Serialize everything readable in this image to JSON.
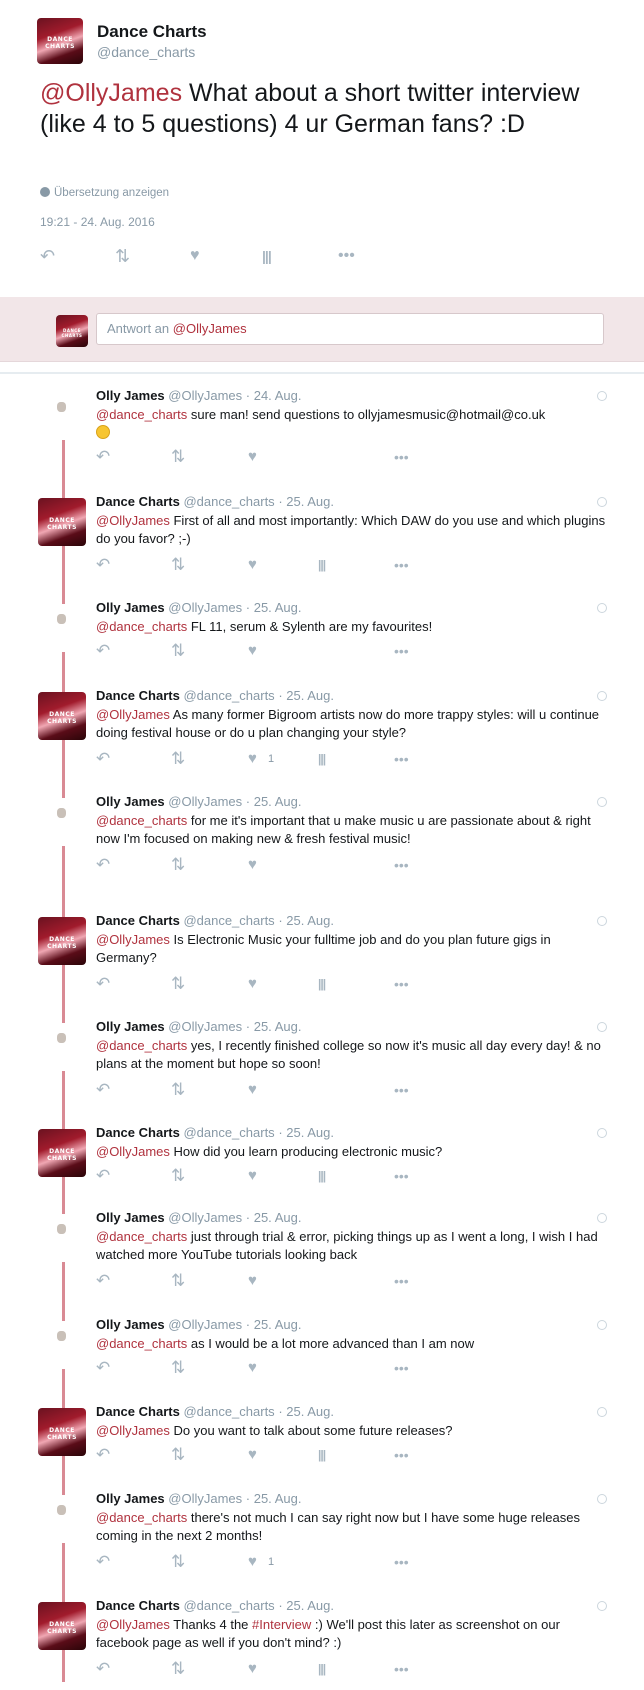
{
  "main_tweet": {
    "author_name": "Dance Charts",
    "author_handle": "@dance_charts",
    "mention": "@OllyJames",
    "text": " What about a short twitter interview (like 4 to 5 questions) 4 ur German fans? :D",
    "translate_label": "Übersetzung anzeigen",
    "timestamp": "19:21 - 24. Aug. 2016"
  },
  "reply_box": {
    "prefix": "Antwort an ",
    "mention": "@OllyJames"
  },
  "avatar_text": "DANCE CHARTS",
  "icons": {
    "reply": "reply-icon",
    "retweet": "retweet-icon",
    "like": "heart-icon",
    "analytics": "analytics-icon",
    "more": "more-icon"
  },
  "colors": {
    "accent": "#b0323e",
    "thread_line": "#d98a94",
    "reply_band": "#f2e6e8",
    "icon": "#a8b6c1"
  },
  "tweets": [
    {
      "name": "Olly James",
      "handle": "@OllyJames",
      "date": "· 24. Aug.",
      "mention": "@dance_charts",
      "text": " sure man! send questions to ollyjamesmusic@hotmail@co.uk",
      "likes": ""
    },
    {
      "name": "Dance Charts",
      "handle": "@dance_charts",
      "date": "· 25. Aug.",
      "mention": "@OllyJames",
      "text": " First of all and most importantly: Which DAW do you use and which plugins do you favor? ;-)",
      "likes": ""
    },
    {
      "name": "Olly James",
      "handle": "@OllyJames",
      "date": "· 25. Aug.",
      "mention": "@dance_charts",
      "text": " FL 11, serum & Sylenth are my favourites!",
      "likes": ""
    },
    {
      "name": "Dance Charts",
      "handle": "@dance_charts",
      "date": "· 25. Aug.",
      "mention": "@OllyJames",
      "text": " As many former Bigroom artists now do more trappy styles: will u continue doing festival house or do u plan changing your style?",
      "likes": "1"
    },
    {
      "name": "Olly James",
      "handle": "@OllyJames",
      "date": "· 25. Aug.",
      "mention": "@dance_charts",
      "text": " for me it's important that u make music u are passionate about & right now I'm focused on making new & fresh festival music!",
      "likes": ""
    },
    {
      "name": "Dance Charts",
      "handle": "@dance_charts",
      "date": "· 25. Aug.",
      "mention": "@OllyJames",
      "text": " Is Electronic Music your fulltime job and do you plan future gigs in Germany?",
      "likes": ""
    },
    {
      "name": "Olly James",
      "handle": "@OllyJames",
      "date": "· 25. Aug.",
      "mention": "@dance_charts",
      "text": " yes, I recently finished college so now it's music all day every day! & no plans at the moment but hope so soon!",
      "likes": ""
    },
    {
      "name": "Dance Charts",
      "handle": "@dance_charts",
      "date": "· 25. Aug.",
      "mention": "@OllyJames",
      "text": " How did you learn producing electronic music?",
      "likes": ""
    },
    {
      "name": "Olly James",
      "handle": "@OllyJames",
      "date": "· 25. Aug.",
      "mention": "@dance_charts",
      "text": " just through trial & error, picking things up as I went a long, I wish I had watched more YouTube tutorials looking back",
      "likes": ""
    },
    {
      "name": "Olly James",
      "handle": "@OllyJames",
      "date": "· 25. Aug.",
      "mention": "@dance_charts",
      "text": " as I would be a lot more advanced than I am now",
      "likes": ""
    },
    {
      "name": "Dance Charts",
      "handle": "@dance_charts",
      "date": "· 25. Aug.",
      "mention": "@OllyJames",
      "text": " Do you want to talk about some future releases?",
      "likes": ""
    },
    {
      "name": "Olly James",
      "handle": "@OllyJames",
      "date": "· 25. Aug.",
      "mention": "@dance_charts",
      "text": " there's not much I can say right now but I have some huge releases coming in the next 2 months!",
      "likes": "1"
    },
    {
      "name": "Dance Charts",
      "handle": "@dance_charts",
      "date": "· 25. Aug.",
      "mention": "@OllyJames",
      "text_before": " Thanks 4 the ",
      "hashtag": "#Interview",
      "text": " :) We'll post this later as screenshot on our facebook page as well if you don't mind? :)",
      "likes": ""
    }
  ]
}
